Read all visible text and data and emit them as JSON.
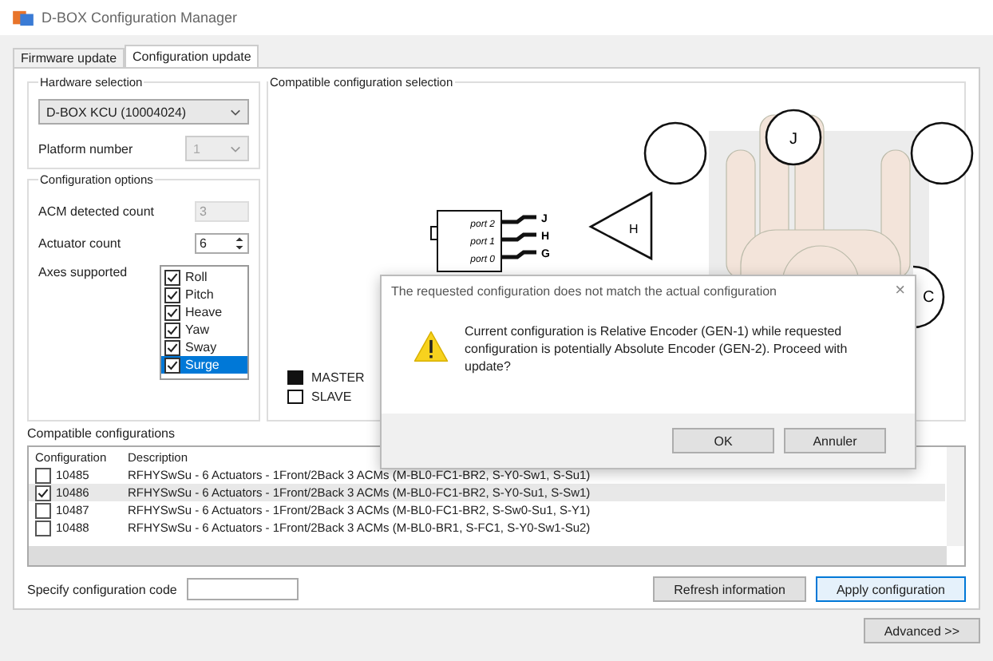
{
  "window": {
    "title": "D-BOX Configuration Manager"
  },
  "tabs": [
    {
      "label": "Firmware update",
      "selected": false
    },
    {
      "label": "Configuration update",
      "selected": true
    }
  ],
  "hardware": {
    "title": "Hardware selection",
    "device": "D-BOX KCU (10004024)",
    "platform_label": "Platform number",
    "platform_value": "1",
    "platform_disabled": true
  },
  "options": {
    "title": "Configuration options",
    "acm_label": "ACM detected count",
    "acm_value": "3",
    "actuator_label": "Actuator count",
    "actuator_value": "6",
    "axes_label": "Axes supported",
    "axes": [
      {
        "label": "Roll",
        "checked": true,
        "selected": false
      },
      {
        "label": "Pitch",
        "checked": true,
        "selected": false
      },
      {
        "label": "Heave",
        "checked": true,
        "selected": false
      },
      {
        "label": "Yaw",
        "checked": true,
        "selected": false
      },
      {
        "label": "Sway",
        "checked": true,
        "selected": false
      },
      {
        "label": "Surge",
        "checked": true,
        "selected": true
      }
    ]
  },
  "diagram": {
    "title": "Compatible configuration selection",
    "ports": [
      {
        "port": "port 2",
        "pin": "J"
      },
      {
        "port": "port 1",
        "pin": "H"
      },
      {
        "port": "port 0",
        "pin": "G"
      }
    ],
    "triangle_label": "H",
    "top_circle": "J",
    "corner_circle": "C",
    "legend": [
      {
        "label": "MASTER",
        "filled": true
      },
      {
        "label": "SLAVE",
        "filled": false
      }
    ]
  },
  "dialog": {
    "title": "The requested configuration does not match the actual configuration",
    "close": "×",
    "message": "Current configuration is Relative Encoder (GEN-1) while requested configuration is potentially Absolute Encoder (GEN-2). Proceed with update?",
    "buttons": [
      "OK",
      "Annuler"
    ]
  },
  "configurations": {
    "title": "Compatible configurations",
    "columns": [
      "Configuration",
      "Description"
    ],
    "rows": [
      {
        "code": "10485",
        "description": "RFHYSwSu - 6 Actuators - 1Front/2Back 3 ACMs (M-BL0-FC1-BR2, S-Y0-Sw1, S-Su1)",
        "checked": false,
        "selected": false
      },
      {
        "code": "10486",
        "description": "RFHYSwSu - 6 Actuators - 1Front/2Back 3 ACMs (M-BL0-FC1-BR2, S-Y0-Su1, S-Sw1)",
        "checked": true,
        "selected": true
      },
      {
        "code": "10487",
        "description": "RFHYSwSu - 6 Actuators - 1Front/2Back 3 ACMs (M-BL0-FC1-BR2, S-Sw0-Su1, S-Y1)",
        "checked": false,
        "selected": false
      },
      {
        "code": "10488",
        "description": "RFHYSwSu - 6 Actuators - 1Front/2Back 3 ACMs (M-BL0-BR1, S-FC1, S-Y0-Sw1-Su2)",
        "checked": false,
        "selected": false
      }
    ]
  },
  "code_label": "Specify configuration code",
  "refresh_button": "Refresh information",
  "apply_button": "Apply configuration",
  "advanced_button": "Advanced >>"
}
